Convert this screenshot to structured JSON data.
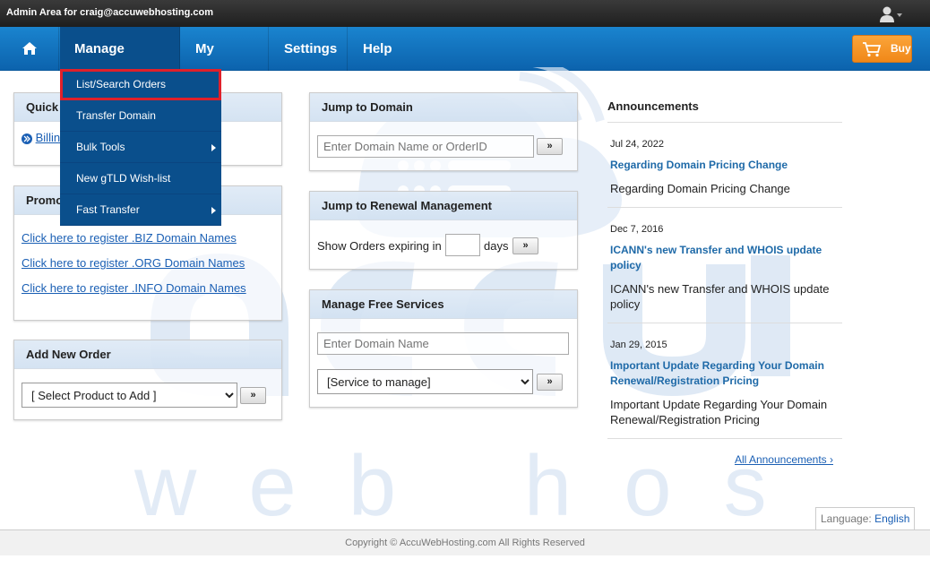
{
  "topbar": {
    "admin_text": "Admin Area for craig@accuwebhosting.com",
    "user_menu_icon": "user-icon"
  },
  "nav": {
    "home_icon": "home-icon",
    "items": [
      "Manage Orders",
      "My Billing",
      "Settings",
      "Help"
    ],
    "buy_label": "Buy"
  },
  "dropdown": {
    "items": [
      {
        "label": "List/Search Orders",
        "submenu": false,
        "highlighted": true
      },
      {
        "label": "Transfer Domain",
        "submenu": false
      },
      {
        "label": "Bulk Tools",
        "submenu": true
      },
      {
        "label": "New gTLD Wish-list",
        "submenu": false
      },
      {
        "label": "Fast Transfer",
        "submenu": true
      }
    ]
  },
  "quick_panel": {
    "title": "Quick",
    "link": "Billin"
  },
  "promo_panel": {
    "title": "Promo",
    "links": [
      "Click here to register .BIZ Domain Names",
      "Click here to register .ORG Domain Names",
      "Click here to register .INFO Domain Names"
    ]
  },
  "add_order_panel": {
    "title": "Add New Order",
    "select_value": "[ Select Product to Add ]",
    "go_label": "»"
  },
  "jump_domain_panel": {
    "title": "Jump to Domain",
    "placeholder": "Enter Domain Name or OrderID",
    "go_label": "»"
  },
  "jump_renewal_panel": {
    "title": "Jump to Renewal Management",
    "prefix": "Show Orders expiring in",
    "suffix": "days",
    "go_label": "»"
  },
  "free_services_panel": {
    "title": "Manage Free Services",
    "placeholder": "Enter Domain Name",
    "select_value": "[Service to manage]",
    "go_label": "»"
  },
  "announcements": {
    "title": "Announcements",
    "entries": [
      {
        "date": "Jul 24, 2022",
        "title": "Regarding Domain Pricing Change",
        "desc": "Regarding Domain Pricing Change"
      },
      {
        "date": "Dec 7, 2016",
        "title": "ICANN's new Transfer and WHOIS update policy",
        "desc": "ICANN's new Transfer and WHOIS update policy"
      },
      {
        "date": "Jan 29, 2015",
        "title": "Important Update Regarding Your Domain Renewal/Registration Pricing",
        "desc": "Important Update Regarding Your Domain Renewal/Registration Pricing"
      }
    ],
    "all_label": "All Announcements ›"
  },
  "language": {
    "label": "Language:",
    "value": "English"
  },
  "footer": {
    "copyright": "Copyright © AccuWebHosting.com All Rights Reserved"
  },
  "watermark": {
    "brand_text": "acc u",
    "sub_text": "web hosting"
  },
  "colors": {
    "nav_blue": "#0c63ad",
    "buy_orange": "#f08818",
    "highlight_red": "#e0202a"
  }
}
